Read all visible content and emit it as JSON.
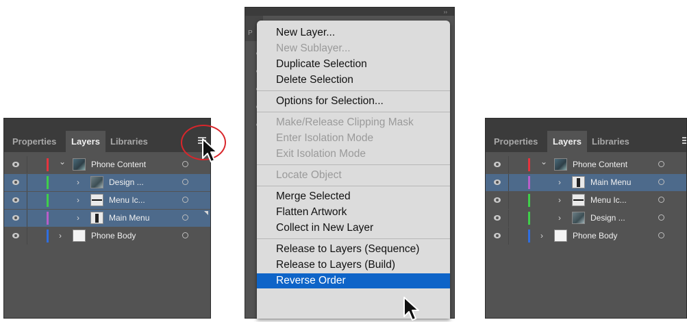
{
  "left_panel": {
    "tabs": [
      "Properties",
      "Layers",
      "Libraries"
    ],
    "active_tab": "Layers",
    "layers": [
      {
        "name": "Phone Content",
        "expanded": true,
        "selected": false,
        "color": "#e5343e",
        "thumb": "phone"
      },
      {
        "name": "Design ...",
        "expanded": false,
        "selected": true,
        "color": "#3fcf4a",
        "thumb": "design"
      },
      {
        "name": "Menu Ic...",
        "expanded": false,
        "selected": true,
        "color": "#3fcf4a",
        "thumb": "menuic"
      },
      {
        "name": "Main Menu",
        "expanded": false,
        "selected": true,
        "color": "#b85ec8",
        "thumb": "mainmenu"
      },
      {
        "name": "Phone Body",
        "expanded": false,
        "selected": false,
        "color": "#2f6ee0",
        "thumb": "body"
      }
    ]
  },
  "context_menu": {
    "items": [
      {
        "label": "New Layer...",
        "enabled": true
      },
      {
        "label": "New Sublayer...",
        "enabled": false
      },
      {
        "label": "Duplicate Selection",
        "enabled": true
      },
      {
        "label": "Delete Selection",
        "enabled": true
      },
      {
        "separator": true
      },
      {
        "label": "Options for Selection...",
        "enabled": true
      },
      {
        "separator": true
      },
      {
        "label": "Make/Release Clipping Mask",
        "enabled": false
      },
      {
        "label": "Enter Isolation Mode",
        "enabled": false
      },
      {
        "label": "Exit Isolation Mode",
        "enabled": false
      },
      {
        "separator": true
      },
      {
        "label": "Locate Object",
        "enabled": false
      },
      {
        "separator": true
      },
      {
        "label": "Merge Selected",
        "enabled": true
      },
      {
        "label": "Flatten Artwork",
        "enabled": true
      },
      {
        "label": "Collect in New Layer",
        "enabled": true
      },
      {
        "separator": true
      },
      {
        "label": "Release to Layers (Sequence)",
        "enabled": true
      },
      {
        "label": "Release to Layers (Build)",
        "enabled": true
      },
      {
        "label": "Reverse Order",
        "enabled": true,
        "highlighted": true
      }
    ],
    "highlight_color": "#0e64c8"
  },
  "right_panel": {
    "tabs": [
      "Properties",
      "Layers",
      "Libraries"
    ],
    "active_tab": "Layers",
    "layers": [
      {
        "name": "Phone Content",
        "expanded": true,
        "selected": false,
        "color": "#e5343e",
        "thumb": "phone"
      },
      {
        "name": "Main Menu",
        "expanded": false,
        "selected": true,
        "color": "#b85ec8",
        "thumb": "mainmenu"
      },
      {
        "name": "Menu Ic...",
        "expanded": false,
        "selected": false,
        "color": "#3fcf4a",
        "thumb": "menuic"
      },
      {
        "name": "Design ...",
        "expanded": false,
        "selected": false,
        "color": "#3fcf4a",
        "thumb": "design"
      },
      {
        "name": "Phone Body",
        "expanded": false,
        "selected": false,
        "color": "#2f6ee0",
        "thumb": "body"
      }
    ]
  }
}
